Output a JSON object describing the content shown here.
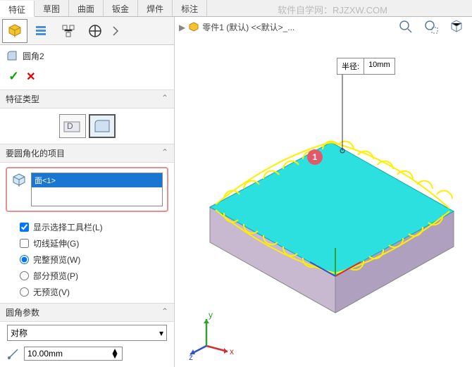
{
  "tabs": {
    "features": "特征",
    "sketch": "草图",
    "surface": "曲面",
    "sheetmetal": "钣金",
    "weldments": "焊件",
    "annotate": "标注"
  },
  "watermark": "软件自学网：RJZXW.COM",
  "feature": {
    "name": "圆角2"
  },
  "sections": {
    "type": "特征类型",
    "items": "要圆角化的项目",
    "params": "圆角参数"
  },
  "selection": {
    "face": "面<1>"
  },
  "options": {
    "showToolbar": "显示选择工具栏(L)",
    "tangent": "切线延伸(G)",
    "fullPreview": "完整预览(W)",
    "partialPreview": "部分预览(P)",
    "noPreview": "无预览(V)"
  },
  "params": {
    "symmetry": "对称",
    "radius": "10.00mm"
  },
  "breadcrumb": {
    "part": "零件1 (默认) <<默认>_..."
  },
  "callout": {
    "label": "半径:",
    "value": "10mm"
  },
  "marker": "1",
  "axis": {
    "x": "x",
    "y": "y",
    "z": "z"
  }
}
